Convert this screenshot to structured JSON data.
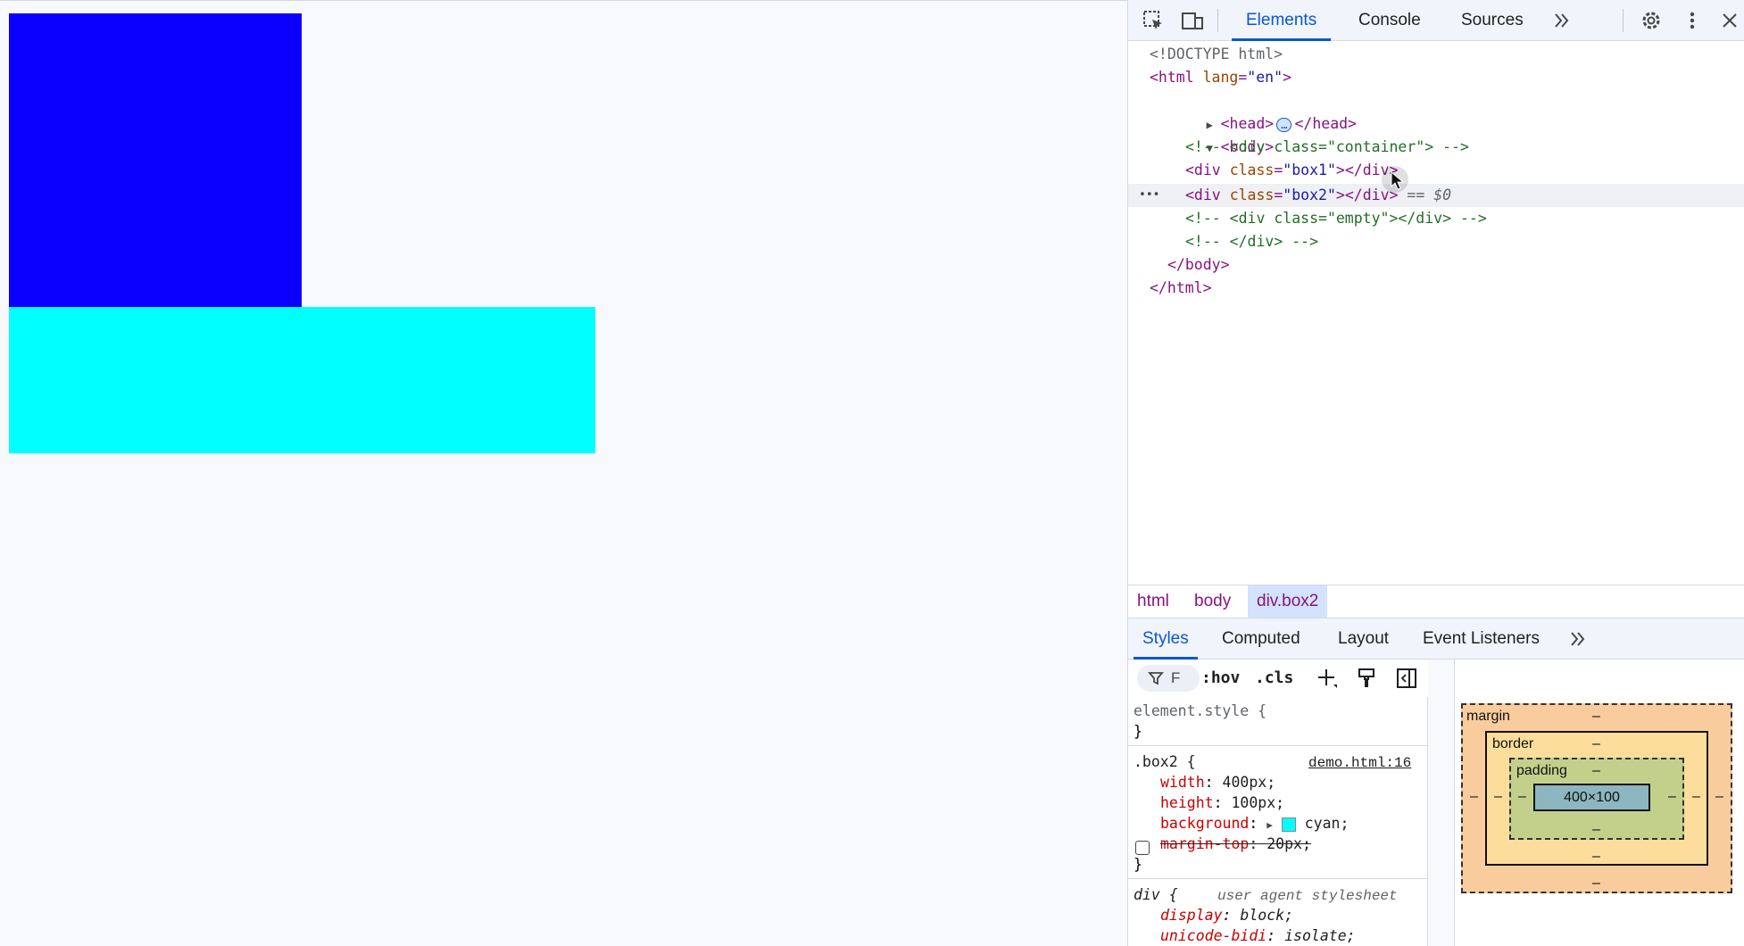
{
  "viewport": {
    "box1_color": "#0b00ff",
    "box2_color": "#00ffff"
  },
  "devtools": {
    "tabs": [
      "Elements",
      "Console",
      "Sources"
    ],
    "active_tab": "Elements",
    "icons": [
      "inspect-element-icon",
      "device-toolbar-icon",
      "more-tabs-chevron-icon",
      "settings-gear-icon",
      "kebab-menu-icon",
      "close-icon"
    ],
    "dom": {
      "doctype": "<!DOCTYPE html>",
      "html_open": "<html",
      "html_attr": "lang",
      "html_val": "\"en\"",
      "html_close_bracket": ">",
      "head_open": "<head>",
      "head_ellipsis": "…",
      "head_close": "</head>",
      "body_open": "<body>",
      "comment1": "<!-- <div class=\"container\"> -->",
      "div_open": "<div",
      "class_attr": "class",
      "eq": "=",
      "box1_val": "\"box1\"",
      "box2_val": "\"box2\"",
      "div_close": "></div>",
      "selected_marker": "== $0",
      "row_dots": "•••",
      "comment2": "<!-- <div class=\"empty\"></div> -->",
      "comment3": "<!-- </div> -->",
      "body_close": "</body>",
      "html_close": "</html>"
    },
    "breadcrumbs": [
      "html",
      "body",
      "div.box2"
    ],
    "subtabs": [
      "Styles",
      "Computed",
      "Layout",
      "Event Listeners"
    ],
    "styles_toolbar": {
      "filter_label": "F",
      "hov": ":hov",
      "cls": ".cls"
    },
    "rules": {
      "element_style_selector": "element.style {",
      "close_brace": "}",
      "box2_selector": ".box2 {",
      "box2_source": "demo.html:16",
      "width_prop": "width",
      "width_val": "400px;",
      "height_prop": "height",
      "height_val": "100px;",
      "bg_prop": "background",
      "bg_val": "cyan;",
      "bg_swatch": "#00ffff",
      "margin_prop": "margin-top",
      "margin_val": "20px;",
      "margin_checked": false,
      "div_selector": "div {",
      "div_source": "user agent stylesheet",
      "display_prop": "display",
      "display_val": "block;",
      "unicode_prop": "unicode-bidi",
      "unicode_val": "isolate;",
      "colon": ":"
    },
    "box_model": {
      "margin_label": "margin",
      "border_label": "border",
      "padding_label": "padding",
      "content_size": "400×100",
      "dash": "–"
    }
  }
}
